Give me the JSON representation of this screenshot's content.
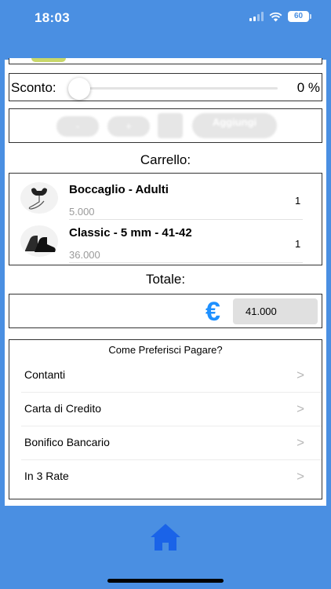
{
  "status": {
    "time": "18:03",
    "battery": "60"
  },
  "discount": {
    "label": "Sconto:",
    "value": "0 %"
  },
  "controls": {
    "minus": "-",
    "plus": "+",
    "add": "Aggiungi"
  },
  "cart": {
    "title": "Carrello:",
    "items": [
      {
        "name": "Boccaglio - Adulti",
        "price": "5.000",
        "qty": "1"
      },
      {
        "name": "Classic - 5 mm - 41-42",
        "price": "36.000",
        "qty": "1"
      }
    ]
  },
  "total": {
    "title": "Totale:",
    "currency": "€",
    "value": "41.000"
  },
  "payment": {
    "title": "Come Preferisci Pagare?",
    "options": [
      {
        "label": "Contanti"
      },
      {
        "label": "Carta di Credito"
      },
      {
        "label": "Bonifico Bancario"
      },
      {
        "label": "In 3 Rate"
      }
    ]
  },
  "colors": {
    "background": "#4a8fe2",
    "euro": "#1e90ff",
    "home": "#1a63e8"
  }
}
